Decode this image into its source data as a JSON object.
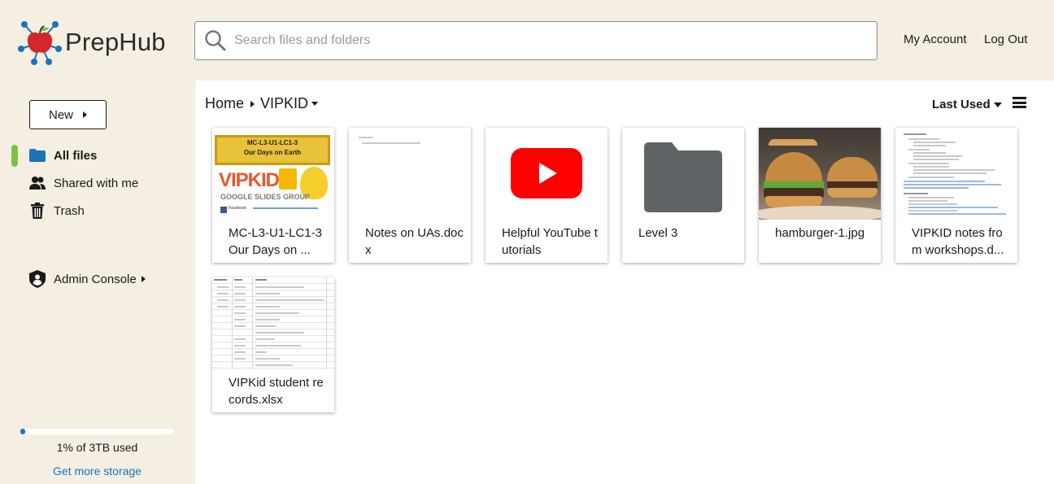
{
  "app": {
    "name": "PrepHub"
  },
  "search": {
    "placeholder": "Search files and folders",
    "value": ""
  },
  "header": {
    "account": "My Account",
    "logout": "Log Out"
  },
  "sidebar": {
    "new_label": "New",
    "items": [
      {
        "label": "All files",
        "icon": "folder-icon",
        "active": true
      },
      {
        "label": "Shared with me",
        "icon": "people-icon"
      },
      {
        "label": "Trash",
        "icon": "trash-icon"
      }
    ],
    "admin_label": "Admin Console",
    "storage": {
      "used_fraction": 0.01,
      "text": "1% of 3TB used",
      "more": "Get more storage"
    }
  },
  "breadcrumb": {
    "home": "Home",
    "current": "VIPKID"
  },
  "sort": {
    "label": "Last Used"
  },
  "files": [
    {
      "name": "MC-L3-U1-LC1-3 Our Days on ...",
      "kind": "slides",
      "thumb_title": "MC-L3-U1-LC1-3",
      "thumb_subtitle": "Our Days on Earth",
      "thumb_brand": "VIPKID",
      "thumb_group": "GOOGLE SLIDES GROUP",
      "thumb_fb": "Facebook"
    },
    {
      "name": "Notes on UAs.docx",
      "kind": "doc"
    },
    {
      "name": "Helpful YouTube tutorials",
      "kind": "youtube"
    },
    {
      "name": "Level 3",
      "kind": "folder"
    },
    {
      "name": "hamburger-1.jpg",
      "kind": "image"
    },
    {
      "name": "VIPKID notes from workshops.d...",
      "kind": "doc"
    },
    {
      "name": "VIPKid student records.xlsx",
      "kind": "sheet"
    }
  ],
  "colors": {
    "accent_green": "#7fc242",
    "link_blue": "#1a73b9",
    "youtube_red": "#ff0000",
    "folder_gray": "#5f6566",
    "bg_beige": "#f4efe2"
  }
}
